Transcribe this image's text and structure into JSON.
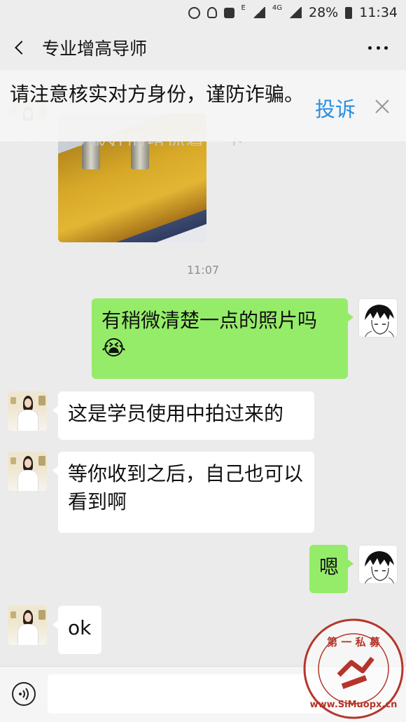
{
  "status_bar": {
    "extra_label": "E",
    "network": "4G",
    "battery": "28%",
    "time": "11:34"
  },
  "header": {
    "title": "专业增高导师"
  },
  "warning": {
    "text": "请注意核实对方身份，谨防诈骗。",
    "report": "投诉",
    "ghost_text": "拎服好的给你看一下"
  },
  "chat": {
    "timestamp": "11:07",
    "messages": [
      {
        "from": "me",
        "text": "有稍微清楚一点的照片吗",
        "emoji": "😭"
      },
      {
        "from": "other",
        "text": "这是学员使用中拍过来的"
      },
      {
        "from": "other",
        "text": "等你收到之后，自己也可以看到啊"
      },
      {
        "from": "me",
        "text": "嗯"
      },
      {
        "from": "other",
        "text": "ok"
      }
    ]
  },
  "watermark": {
    "top_text": "第 一 私 募",
    "ring_text": "www.SiMuopx.cn"
  },
  "colors": {
    "accent_link": "#2a8ee0",
    "bubble_me": "#95ec69",
    "bubble_other": "#ffffff",
    "background": "#ebebeb",
    "watermark": "#b5352a"
  },
  "icons": [
    "back-icon",
    "more-icon",
    "close-icon",
    "voice-icon",
    "alarm-icon",
    "wifi-hotspot-icon",
    "signal-icon",
    "battery-icon"
  ]
}
